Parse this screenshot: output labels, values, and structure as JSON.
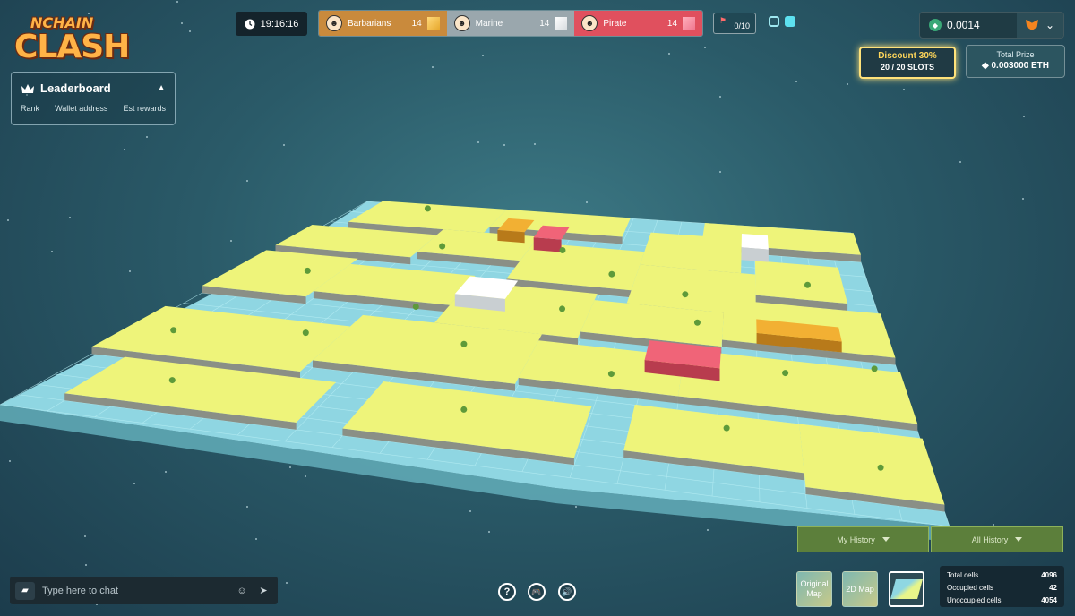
{
  "logo": {
    "top": "NCHAIN",
    "main": "CLASH"
  },
  "leaderboard": {
    "title": "Leaderboard",
    "columns": [
      "Rank",
      "Wallet address",
      "Est rewards"
    ]
  },
  "timer": {
    "value": "19:16:16"
  },
  "teams": [
    {
      "name": "Barbarians",
      "count": "14",
      "color": "#c98a3c"
    },
    {
      "name": "Marine",
      "count": "14",
      "color": "#9aa7ad"
    },
    {
      "name": "Pirate",
      "count": "14",
      "color": "#e0505e"
    }
  ],
  "flags": {
    "value": "0/10"
  },
  "wallet": {
    "balance": "0.0014"
  },
  "discount": {
    "title": "Discount 30%",
    "slots": "20 / 20 SLOTS"
  },
  "prize": {
    "label": "Total Prize",
    "value": "0.003000 ETH"
  },
  "history": {
    "my": "My History",
    "all": "All History"
  },
  "map_modes": {
    "original": "Original Map",
    "twod": "2D Map"
  },
  "cells": {
    "total_label": "Total cells",
    "total": "4096",
    "occupied_label": "Occupied cells",
    "occupied": "42",
    "unoccupied_label": "Unoccupied cells",
    "unoccupied": "4054"
  },
  "chat": {
    "placeholder": "Type here to chat"
  },
  "buttons": {
    "help": "?",
    "game": "🎮",
    "sound": "🔊"
  },
  "colors": {
    "land": "#eef47a",
    "water": "#a8e6ee",
    "barbarians": "#f2b033",
    "marine": "#ffffff",
    "pirate": "#f06478"
  }
}
